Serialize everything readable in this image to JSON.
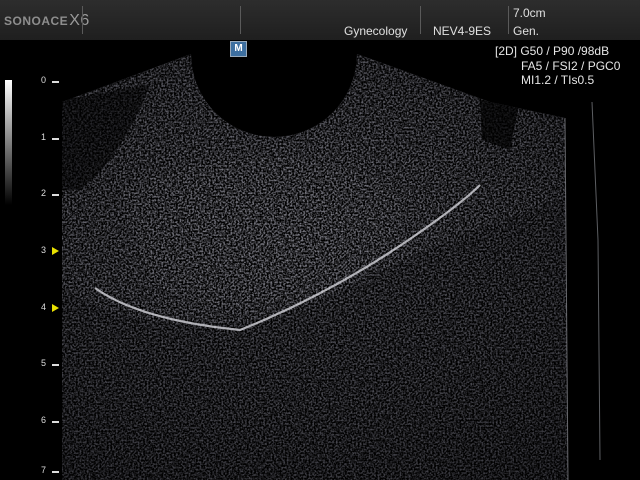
{
  "header": {
    "brand": "SONOACE",
    "model": "X6",
    "preset": "Gynecology",
    "probe": "NEV4-9ES",
    "depth": "7.0cm",
    "mode": "Gen."
  },
  "params": {
    "line1": "[2D] G50 / P90 /98dB",
    "line2": "FA5 / FSI2 / PGC0",
    "line3": "MI1.2 / TIs0.5"
  },
  "orientation_marker": "M",
  "depth_scale": {
    "ticks": [
      "0",
      "1",
      "2",
      "3",
      "4",
      "5",
      "6",
      "7"
    ],
    "focus_markers": [
      "3",
      "4"
    ]
  },
  "colors": {
    "background": "#000000",
    "header": "#262626",
    "focus_marker": "#e8e000",
    "orientation_marker": "#3d6fa0"
  },
  "icons": [
    "orientation-marker-icon",
    "focus-marker-icon"
  ]
}
